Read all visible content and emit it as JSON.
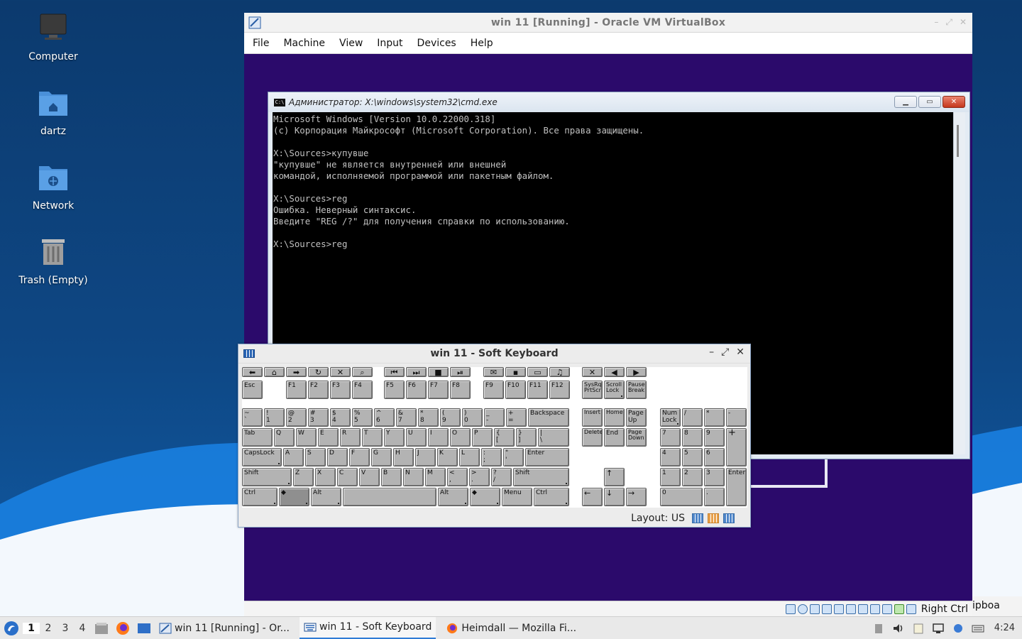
{
  "desktop": {
    "icons": [
      {
        "label": "Computer"
      },
      {
        "label": "dartz"
      },
      {
        "label": "Network"
      },
      {
        "label": "Trash (Empty)"
      }
    ]
  },
  "vbox": {
    "title": "win 11 [Running] - Oracle VM VirtualBox",
    "menu": [
      "File",
      "Machine",
      "View",
      "Input",
      "Devices",
      "Help"
    ],
    "host_key": "Right Ctrl"
  },
  "cmd": {
    "title": "Администратор: X:\\windows\\system32\\cmd.exe",
    "lines": [
      "Microsoft Windows [Version 10.0.22000.318]",
      "(c) Корпорация Майкрософт (Microsoft Corporation). Все права защищены.",
      "",
      "X:\\Sources>купувше",
      "\"купувше\" не является внутренней или внешней",
      "командой, исполняемой программой или пакетным файлом.",
      "",
      "X:\\Sources>reg",
      "Ошибка. Неверный синтаксис.",
      "Введите \"REG /?\" для получения справки по использованию.",
      "",
      "X:\\Sources>reg"
    ]
  },
  "keyboard": {
    "title": "win 11 - Soft Keyboard",
    "layout_label": "Layout: US"
  },
  "side_window": {
    "fragment": "ipboa"
  },
  "taskbar": {
    "workspaces": [
      "1",
      "2",
      "3",
      "4"
    ],
    "tasks": [
      {
        "label": "win 11 [Running] - Or..."
      },
      {
        "label": "win 11 - Soft Keyboard"
      },
      {
        "label": "Heimdall — Mozilla Fi..."
      }
    ],
    "clock": "4:24"
  },
  "colors": {
    "guest_bg": "#2b0a6b",
    "accent": "#2f7cd6"
  }
}
